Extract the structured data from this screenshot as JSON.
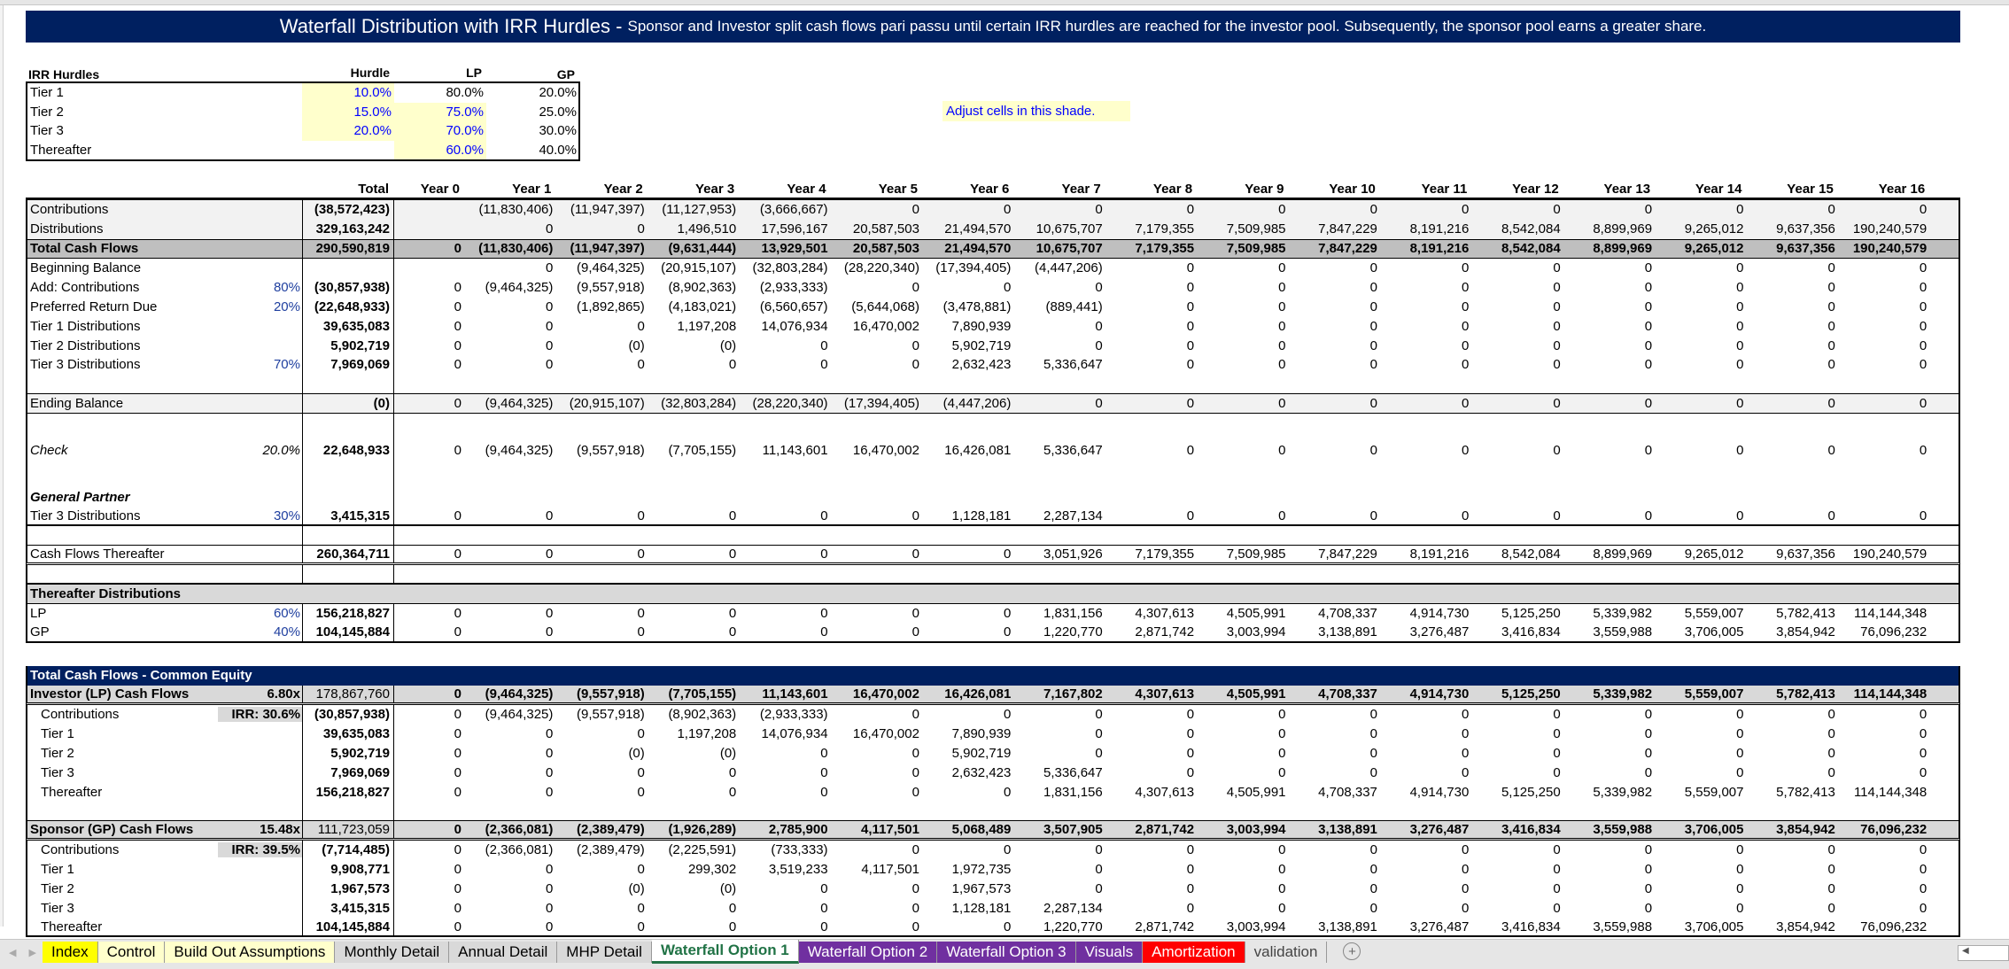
{
  "banner": {
    "title": "Waterfall Distribution with IRR Hurdles -",
    "subtitle": "Sponsor and Investor split cash flows pari passu until certain IRR hurdles are reached for the investor pool. Subsequently, the sponsor pool earns a greater share."
  },
  "irr_hurdles": {
    "header": {
      "label": "IRR Hurdles",
      "hurdle": "Hurdle",
      "lp": "LP",
      "gp": "GP"
    },
    "rows": [
      {
        "label": "Tier 1",
        "hurdle": "10.0%",
        "lp": "80.0%",
        "gp": "20.0%"
      },
      {
        "label": "Tier 2",
        "hurdle": "15.0%",
        "lp": "75.0%",
        "gp": "25.0%"
      },
      {
        "label": "Tier 3",
        "hurdle": "20.0%",
        "lp": "70.0%",
        "gp": "30.0%"
      },
      {
        "label": "Thereafter",
        "hurdle": "",
        "lp": "60.0%",
        "gp": "40.0%"
      }
    ]
  },
  "note": "Adjust cells in this shade.",
  "colors": {
    "navy": "#002060",
    "input_shade": "#ffffcc",
    "input_text": "#0000ff",
    "active_tab": "#217346"
  },
  "columns": [
    "Total",
    "Year 0",
    "Year 1",
    "Year 2",
    "Year 3",
    "Year 4",
    "Year 5",
    "Year 6",
    "Year 7",
    "Year 8",
    "Year 9",
    "Year 10",
    "Year 11",
    "Year 12",
    "Year 13",
    "Year 14",
    "Year 15",
    "Year 16"
  ],
  "rows": {
    "contributions": {
      "label": "Contributions",
      "pct": "",
      "total": "(38,572,423)",
      "years": [
        "",
        "(11,830,406)",
        "(11,947,397)",
        "(11,127,953)",
        "(3,666,667)",
        "0",
        "0",
        "0",
        "0",
        "0",
        "0",
        "0",
        "0",
        "0",
        "0",
        "0",
        "0"
      ]
    },
    "distributions": {
      "label": "Distributions",
      "pct": "",
      "total": "329,163,242",
      "years": [
        "",
        "0",
        "0",
        "1,496,510",
        "17,596,167",
        "20,587,503",
        "21,494,570",
        "10,675,707",
        "7,179,355",
        "7,509,985",
        "7,847,229",
        "8,191,216",
        "8,542,084",
        "8,899,969",
        "9,265,012",
        "9,637,356",
        "190,240,579"
      ]
    },
    "total_cash_flows": {
      "label": "Total Cash Flows",
      "pct": "",
      "total": "290,590,819",
      "years": [
        "0",
        "(11,830,406)",
        "(11,947,397)",
        "(9,631,444)",
        "13,929,501",
        "20,587,503",
        "21,494,570",
        "10,675,707",
        "7,179,355",
        "7,509,985",
        "7,847,229",
        "8,191,216",
        "8,542,084",
        "8,899,969",
        "9,265,012",
        "9,637,356",
        "190,240,579"
      ]
    },
    "beginning_balance": {
      "label": "Beginning Balance",
      "pct": "",
      "total": "",
      "years": [
        "",
        "0",
        "(9,464,325)",
        "(20,915,107)",
        "(32,803,284)",
        "(28,220,340)",
        "(17,394,405)",
        "(4,447,206)",
        "0",
        "0",
        "0",
        "0",
        "0",
        "0",
        "0",
        "0",
        "0"
      ]
    },
    "add_contributions": {
      "label": "Add: Contributions",
      "pct": "80%",
      "total": "(30,857,938)",
      "years": [
        "0",
        "(9,464,325)",
        "(9,557,918)",
        "(8,902,363)",
        "(2,933,333)",
        "0",
        "0",
        "0",
        "0",
        "0",
        "0",
        "0",
        "0",
        "0",
        "0",
        "0",
        "0"
      ]
    },
    "preferred_return_due": {
      "label": "Preferred Return Due",
      "pct": "20%",
      "total": "(22,648,933)",
      "years": [
        "0",
        "0",
        "(1,892,865)",
        "(4,183,021)",
        "(6,560,657)",
        "(5,644,068)",
        "(3,478,881)",
        "(889,441)",
        "0",
        "0",
        "0",
        "0",
        "0",
        "0",
        "0",
        "0",
        "0"
      ]
    },
    "tier1_distributions": {
      "label": "Tier 1 Distributions",
      "pct": "",
      "total": "39,635,083",
      "years": [
        "0",
        "0",
        "0",
        "1,197,208",
        "14,076,934",
        "16,470,002",
        "7,890,939",
        "0",
        "0",
        "0",
        "0",
        "0",
        "0",
        "0",
        "0",
        "0",
        "0"
      ]
    },
    "tier2_distributions": {
      "label": "Tier 2 Distributions",
      "pct": "",
      "total": "5,902,719",
      "years": [
        "0",
        "0",
        "(0)",
        "(0)",
        "0",
        "0",
        "5,902,719",
        "0",
        "0",
        "0",
        "0",
        "0",
        "0",
        "0",
        "0",
        "0",
        "0"
      ]
    },
    "tier3_distributions": {
      "label": "Tier 3 Distributions",
      "pct": "70%",
      "total": "7,969,069",
      "years": [
        "0",
        "0",
        "0",
        "0",
        "0",
        "0",
        "2,632,423",
        "5,336,647",
        "0",
        "0",
        "0",
        "0",
        "0",
        "0",
        "0",
        "0",
        "0"
      ]
    },
    "ending_balance": {
      "label": "Ending Balance",
      "pct": "",
      "total": "(0)",
      "years": [
        "0",
        "(9,464,325)",
        "(20,915,107)",
        "(32,803,284)",
        "(28,220,340)",
        "(17,394,405)",
        "(4,447,206)",
        "0",
        "0",
        "0",
        "0",
        "0",
        "0",
        "0",
        "0",
        "0",
        "0"
      ]
    },
    "check": {
      "label": "Check",
      "pct": "20.0%",
      "total": "22,648,933",
      "years": [
        "0",
        "(9,464,325)",
        "(9,557,918)",
        "(7,705,155)",
        "11,143,601",
        "16,470,002",
        "16,426,081",
        "5,336,647",
        "0",
        "0",
        "0",
        "0",
        "0",
        "0",
        "0",
        "0",
        "0"
      ]
    },
    "general_partner": {
      "label": "General Partner"
    },
    "gp_tier3_distributions": {
      "label": "Tier 3 Distributions",
      "pct": "30%",
      "total": "3,415,315",
      "years": [
        "0",
        "0",
        "0",
        "0",
        "0",
        "0",
        "1,128,181",
        "2,287,134",
        "0",
        "0",
        "0",
        "0",
        "0",
        "0",
        "0",
        "0",
        "0"
      ]
    },
    "cash_flows_thereafter": {
      "label": "Cash Flows Thereafter",
      "pct": "",
      "total": "260,364,711",
      "years": [
        "0",
        "0",
        "0",
        "0",
        "0",
        "0",
        "0",
        "3,051,926",
        "7,179,355",
        "7,509,985",
        "7,847,229",
        "8,191,216",
        "8,542,084",
        "8,899,969",
        "9,265,012",
        "9,637,356",
        "190,240,579"
      ]
    },
    "thereafter_header": {
      "label": "Thereafter Distributions"
    },
    "thereafter_lp": {
      "label": "LP",
      "pct": "60%",
      "total": "156,218,827",
      "years": [
        "0",
        "0",
        "0",
        "0",
        "0",
        "0",
        "0",
        "1,831,156",
        "4,307,613",
        "4,505,991",
        "4,708,337",
        "4,914,730",
        "5,125,250",
        "5,339,982",
        "5,559,007",
        "5,782,413",
        "114,144,348"
      ]
    },
    "thereafter_gp": {
      "label": "GP",
      "pct": "40%",
      "total": "104,145,884",
      "years": [
        "0",
        "0",
        "0",
        "0",
        "0",
        "0",
        "0",
        "1,220,770",
        "2,871,742",
        "3,003,994",
        "3,138,891",
        "3,276,487",
        "3,416,834",
        "3,559,988",
        "3,706,005",
        "3,854,942",
        "76,096,232"
      ]
    },
    "common_equity_header": {
      "label": "Total Cash Flows - Common Equity"
    },
    "lp_cash_flows": {
      "label": "Investor (LP) Cash Flows",
      "pct": "6.80x",
      "total": "178,867,760",
      "years": [
        "0",
        "(9,464,325)",
        "(9,557,918)",
        "(7,705,155)",
        "11,143,601",
        "16,470,002",
        "16,426,081",
        "7,167,802",
        "4,307,613",
        "4,505,991",
        "4,708,337",
        "4,914,730",
        "5,125,250",
        "5,339,982",
        "5,559,007",
        "5,782,413",
        "114,144,348"
      ]
    },
    "lp_contributions": {
      "label": "Contributions",
      "pct": "IRR: 30.6%",
      "total": "(30,857,938)",
      "years": [
        "0",
        "(9,464,325)",
        "(9,557,918)",
        "(8,902,363)",
        "(2,933,333)",
        "0",
        "0",
        "0",
        "0",
        "0",
        "0",
        "0",
        "0",
        "0",
        "0",
        "0",
        "0"
      ]
    },
    "lp_tier1": {
      "label": "Tier 1",
      "pct": "",
      "total": "39,635,083",
      "years": [
        "0",
        "0",
        "0",
        "1,197,208",
        "14,076,934",
        "16,470,002",
        "7,890,939",
        "0",
        "0",
        "0",
        "0",
        "0",
        "0",
        "0",
        "0",
        "0",
        "0"
      ]
    },
    "lp_tier2": {
      "label": "Tier 2",
      "pct": "",
      "total": "5,902,719",
      "years": [
        "0",
        "0",
        "(0)",
        "(0)",
        "0",
        "0",
        "5,902,719",
        "0",
        "0",
        "0",
        "0",
        "0",
        "0",
        "0",
        "0",
        "0",
        "0"
      ]
    },
    "lp_tier3": {
      "label": "Tier 3",
      "pct": "",
      "total": "7,969,069",
      "years": [
        "0",
        "0",
        "0",
        "0",
        "0",
        "0",
        "2,632,423",
        "5,336,647",
        "0",
        "0",
        "0",
        "0",
        "0",
        "0",
        "0",
        "0",
        "0"
      ]
    },
    "lp_thereafter": {
      "label": "Thereafter",
      "pct": "",
      "total": "156,218,827",
      "years": [
        "0",
        "0",
        "0",
        "0",
        "0",
        "0",
        "0",
        "1,831,156",
        "4,307,613",
        "4,505,991",
        "4,708,337",
        "4,914,730",
        "5,125,250",
        "5,339,982",
        "5,559,007",
        "5,782,413",
        "114,144,348"
      ]
    },
    "gp_cash_flows": {
      "label": "Sponsor (GP) Cash Flows",
      "pct": "15.48x",
      "total": "111,723,059",
      "years": [
        "0",
        "(2,366,081)",
        "(2,389,479)",
        "(1,926,289)",
        "2,785,900",
        "4,117,501",
        "5,068,489",
        "3,507,905",
        "2,871,742",
        "3,003,994",
        "3,138,891",
        "3,276,487",
        "3,416,834",
        "3,559,988",
        "3,706,005",
        "3,854,942",
        "76,096,232"
      ]
    },
    "gp_contributions": {
      "label": "Contributions",
      "pct": "IRR: 39.5%",
      "total": "(7,714,485)",
      "years": [
        "0",
        "(2,366,081)",
        "(2,389,479)",
        "(2,225,591)",
        "(733,333)",
        "0",
        "0",
        "0",
        "0",
        "0",
        "0",
        "0",
        "0",
        "0",
        "0",
        "0",
        "0"
      ]
    },
    "gp_tier1": {
      "label": "Tier 1",
      "pct": "",
      "total": "9,908,771",
      "years": [
        "0",
        "0",
        "0",
        "299,302",
        "3,519,233",
        "4,117,501",
        "1,972,735",
        "0",
        "0",
        "0",
        "0",
        "0",
        "0",
        "0",
        "0",
        "0",
        "0"
      ]
    },
    "gp_tier2": {
      "label": "Tier 2",
      "pct": "",
      "total": "1,967,573",
      "years": [
        "0",
        "0",
        "(0)",
        "(0)",
        "0",
        "0",
        "1,967,573",
        "0",
        "0",
        "0",
        "0",
        "0",
        "0",
        "0",
        "0",
        "0",
        "0"
      ]
    },
    "gp_tier3": {
      "label": "Tier 3",
      "pct": "",
      "total": "3,415,315",
      "years": [
        "0",
        "0",
        "0",
        "0",
        "0",
        "0",
        "1,128,181",
        "2,287,134",
        "0",
        "0",
        "0",
        "0",
        "0",
        "0",
        "0",
        "0",
        "0"
      ]
    },
    "gp_thereafter": {
      "label": "Thereafter",
      "pct": "",
      "total": "104,145,884",
      "years": [
        "0",
        "0",
        "0",
        "0",
        "0",
        "0",
        "0",
        "1,220,770",
        "2,871,742",
        "3,003,994",
        "3,138,891",
        "3,276,487",
        "3,416,834",
        "3,559,988",
        "3,706,005",
        "3,854,942",
        "76,096,232"
      ]
    }
  },
  "sheet_tabs": [
    {
      "label": "Index",
      "bg": "#ffff00",
      "fg": "#000000"
    },
    {
      "label": "Control",
      "bg": "#ffffcc",
      "fg": "#000000"
    },
    {
      "label": "Build Out Assumptions",
      "bg": "#ffffcc",
      "fg": "#000000"
    },
    {
      "label": "Monthly Detail",
      "bg": "#d9d9d9",
      "fg": "#000000"
    },
    {
      "label": "Annual Detail",
      "bg": "#d9d9d9",
      "fg": "#000000"
    },
    {
      "label": "MHP Detail",
      "bg": "#d9d9d9",
      "fg": "#000000"
    },
    {
      "label": "Waterfall Option 1",
      "bg": "#ffffff",
      "fg": "#217346",
      "active": true
    },
    {
      "label": "Waterfall Option 2",
      "bg": "#7030a0",
      "fg": "#ffffff"
    },
    {
      "label": "Waterfall Option 3",
      "bg": "#7030a0",
      "fg": "#ffffff"
    },
    {
      "label": "Visuals",
      "bg": "#7030a0",
      "fg": "#ffffff"
    },
    {
      "label": "Amortization",
      "bg": "#ff0000",
      "fg": "#ffffff"
    },
    {
      "label": "validation",
      "bg": "#e6e6e6",
      "fg": "#444444"
    }
  ],
  "add_sheet_label": "+"
}
